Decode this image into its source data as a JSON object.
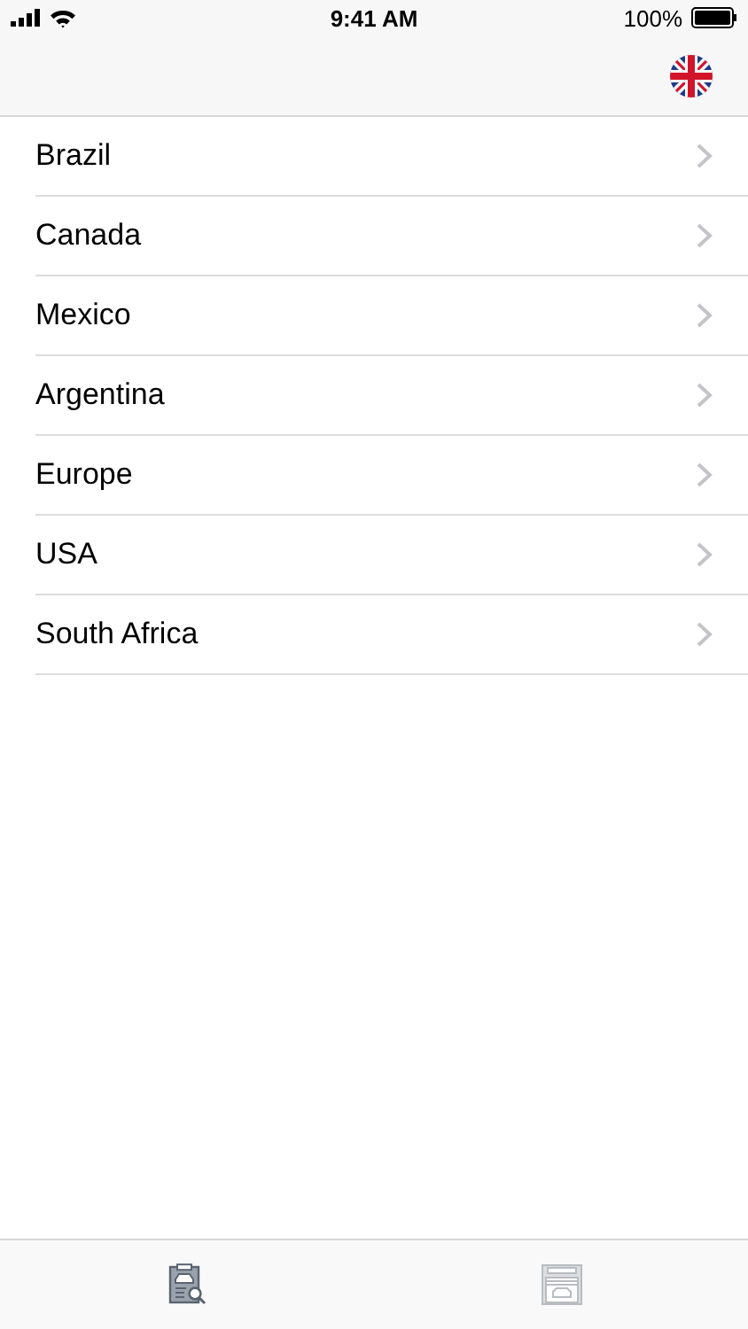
{
  "status_bar": {
    "time": "9:41 AM",
    "battery": "100%"
  },
  "rows": [
    {
      "label": "Brazil"
    },
    {
      "label": "Canada"
    },
    {
      "label": "Mexico"
    },
    {
      "label": "Argentina"
    },
    {
      "label": "Europe"
    },
    {
      "label": "USA"
    },
    {
      "label": "South Africa"
    }
  ],
  "tab_bar": [
    {
      "kind": "inspection",
      "selected": true
    },
    {
      "kind": "garage",
      "selected": false
    }
  ]
}
